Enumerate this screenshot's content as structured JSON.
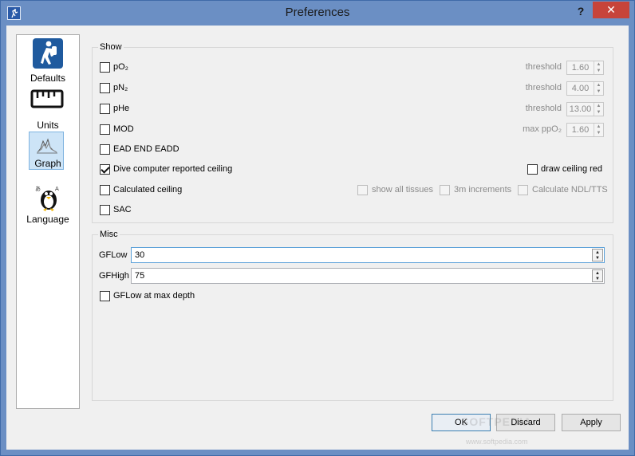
{
  "window": {
    "title": "Preferences",
    "help": "?",
    "close": "✕"
  },
  "sidebar": {
    "items": [
      {
        "label": "Defaults"
      },
      {
        "label": "Units"
      },
      {
        "label": "Graph",
        "selected": true
      },
      {
        "label": "Language"
      }
    ]
  },
  "show": {
    "title": "Show",
    "rows": [
      {
        "label": "pO₂",
        "checked": false,
        "param_label": "threshold",
        "param_value": "1.60"
      },
      {
        "label": "pN₂",
        "checked": false,
        "param_label": "threshold",
        "param_value": "4.00"
      },
      {
        "label": "pHe",
        "checked": false,
        "param_label": "threshold",
        "param_value": "13.00"
      },
      {
        "label": "MOD",
        "checked": false,
        "param_label": "max ppO₂",
        "param_value": "1.60"
      },
      {
        "label": "EAD END EADD",
        "checked": false
      },
      {
        "label": "Dive computer reported ceiling",
        "checked": true
      },
      {
        "label": "Calculated ceiling",
        "checked": false
      },
      {
        "label": "SAC",
        "checked": false
      }
    ],
    "draw_ceiling_red": {
      "label": "draw ceiling red",
      "checked": false
    },
    "show_all_tissues": {
      "label": "show all tissues",
      "checked": false
    },
    "increments_3m": {
      "label": "3m increments",
      "checked": false
    },
    "calculate_ndl_tts": {
      "label": "Calculate NDL/TTS",
      "checked": false
    }
  },
  "misc": {
    "title": "Misc",
    "gflow": {
      "label": "GFLow",
      "value": "30"
    },
    "gfhigh": {
      "label": "GFHigh",
      "value": "75"
    },
    "gflow_max_depth": {
      "label": "GFLow at max depth",
      "checked": false
    }
  },
  "buttons": {
    "ok": "OK",
    "discard": "Discard",
    "apply": "Apply"
  },
  "watermark": {
    "text": "SOFTPEDIA",
    "url": "www.softpedia.com"
  },
  "colors": {
    "titlebar": "#6b8fc4",
    "close": "#c7443a",
    "selection": "#cde4f7",
    "focus": "#5aa0d8"
  }
}
